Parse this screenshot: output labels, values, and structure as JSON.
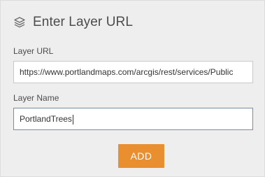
{
  "header": {
    "title": "Enter Layer URL",
    "icon": "layers-icon"
  },
  "layer_url": {
    "label": "Layer URL",
    "value": "https://www.portlandmaps.com/arcgis/rest/services/Public"
  },
  "layer_name": {
    "label": "Layer Name",
    "value": "PortlandTrees"
  },
  "actions": {
    "add_label": "ADD"
  },
  "colors": {
    "panel_bg": "#eeeeee",
    "button_accent": "#ea8f2f",
    "text": "#4c4c4c"
  }
}
